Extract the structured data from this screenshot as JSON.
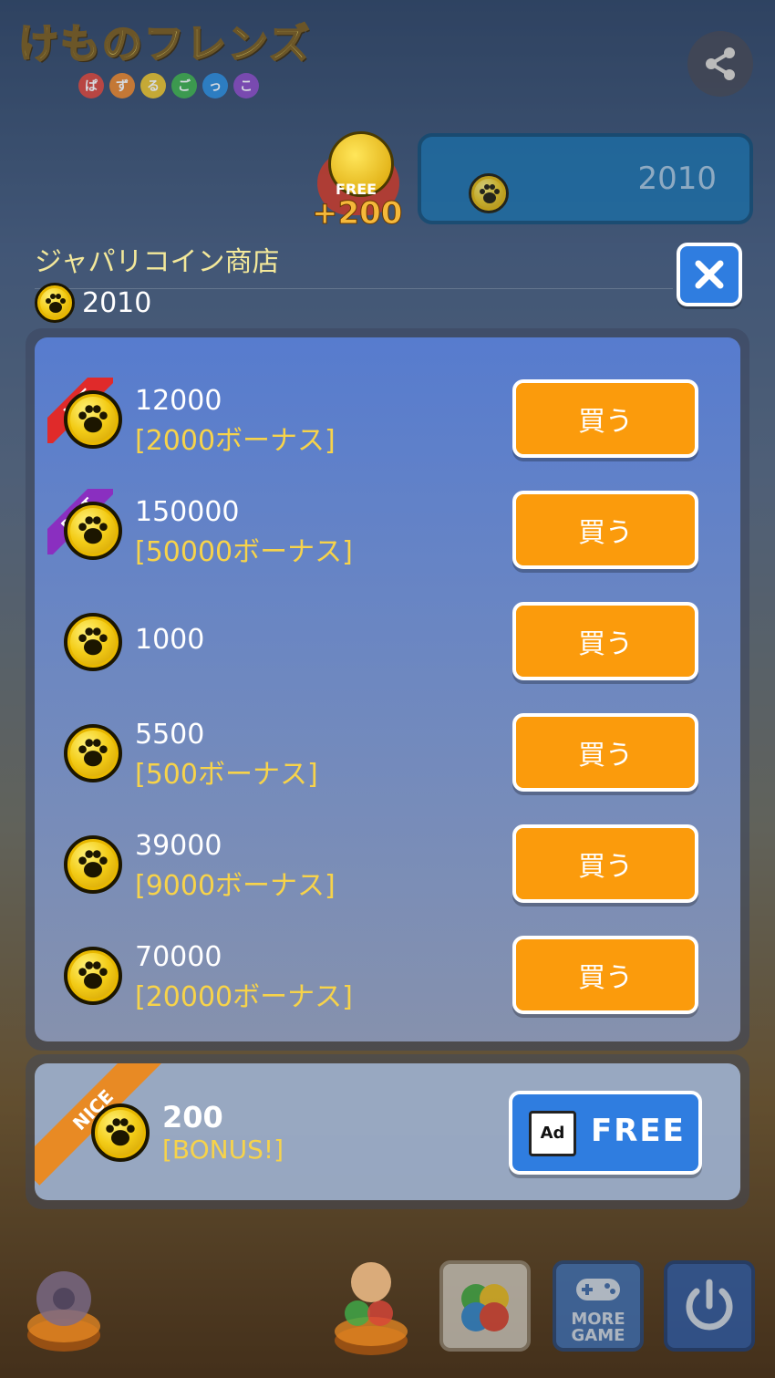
{
  "logo": {
    "title": "けものフレンズ",
    "subtitle_chars": [
      "ぱ",
      "ず",
      "る",
      "ご",
      "っ",
      "こ"
    ],
    "subtitle_colors": [
      "#d9463a",
      "#e8842a",
      "#e9c12a",
      "#3eae4a",
      "#2c8ad8",
      "#8a4bc2"
    ]
  },
  "top_bar": {
    "free_label": "FREE",
    "free_amount": "+200",
    "coin_balance": "2010"
  },
  "store": {
    "title": "ジャパリコイン商店",
    "balance": "2010",
    "items": [
      {
        "amount": "12000",
        "bonus": "[2000ボーナス]",
        "badge": "HOT",
        "buy_label": "買う"
      },
      {
        "amount": "150000",
        "bonus": "[50000ボーナス]",
        "badge": "BEST",
        "buy_label": "買う"
      },
      {
        "amount": "1000",
        "bonus": "",
        "badge": "",
        "buy_label": "買う"
      },
      {
        "amount": "5500",
        "bonus": "[500ボーナス]",
        "badge": "",
        "buy_label": "買う"
      },
      {
        "amount": "39000",
        "bonus": "[9000ボーナス]",
        "badge": "",
        "buy_label": "買う"
      },
      {
        "amount": "70000",
        "bonus": "[20000ボーナス]",
        "badge": "",
        "buy_label": "買う"
      }
    ]
  },
  "bonus_offer": {
    "badge": "NICE",
    "amount": "200",
    "bonus": "[BONUS!]",
    "ad_label": "Ad",
    "button_label": "FREE"
  },
  "bottom_bar": {
    "more_game_line1": "MORE",
    "more_game_line2": "GAME"
  },
  "colors": {
    "buy_button": "#fb9b0c",
    "free_button": "#2f7de0",
    "bonus_text": "#f7d34a",
    "hot_ribbon": "#e02a2a",
    "best_ribbon": "#8a2fc0",
    "nice_ribbon": "#e88a24"
  }
}
